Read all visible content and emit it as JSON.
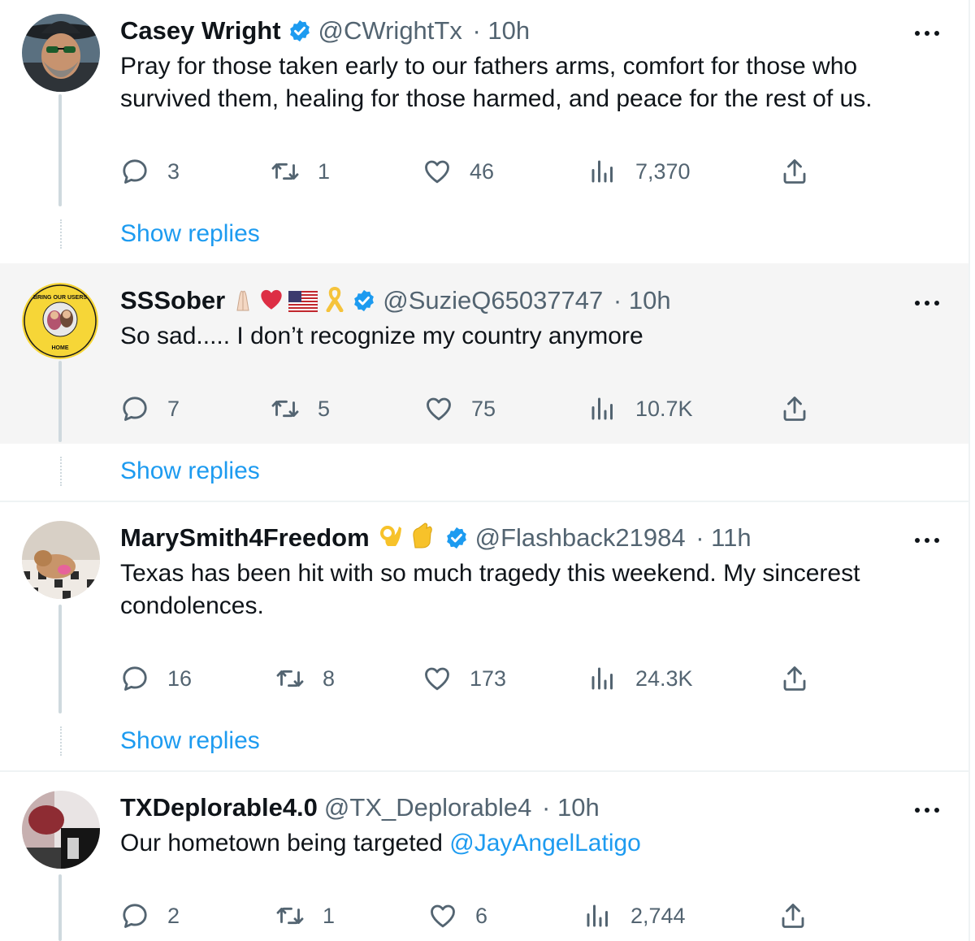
{
  "replies": [
    {
      "name": "Casey Wright",
      "handle": "@CWrightTx",
      "time": "· 10h",
      "verified": true,
      "text": "Pray for those taken early to our fathers arms, comfort for those who survived them, healing for those harmed, and peace for the rest of us.",
      "replies_count": "3",
      "retweets": "1",
      "likes": "46",
      "views": "7,370",
      "show_replies": "Show replies"
    },
    {
      "name": "SSSober",
      "name_emojis": [
        "folded-hands",
        "red-heart",
        "us-flag",
        "yellow-ribbon"
      ],
      "handle": "@SuzieQ65037747",
      "time": "· 10h",
      "verified": true,
      "avatar_text_top": "BRING OUR USERS",
      "avatar_text_bottom": "HOME",
      "text": "So sad..... I don’t recognize my country anymore",
      "replies_count": "7",
      "retweets": "5",
      "likes": "75",
      "views": "10.7K",
      "show_replies": "Show replies"
    },
    {
      "name": "MarySmith4Freedom",
      "name_emojis": [
        "ok-hand",
        "pinching-hand"
      ],
      "handle": "@Flashback21984",
      "time": "· 11h",
      "verified": true,
      "text": "Texas has been hit with so much tragedy this weekend. My sincerest condolences.",
      "replies_count": "16",
      "retweets": "8",
      "likes": "173",
      "views": "24.3K",
      "show_replies": "Show replies"
    },
    {
      "name": "TXDeplorable4.0",
      "handle": "@TX_Deplorable4",
      "time": "· 10h",
      "verified": false,
      "text": "Our hometown being targeted ",
      "mention": "@JayAngelLatigo",
      "replies_count": "2",
      "retweets": "1",
      "likes": "6",
      "views": "2,744"
    }
  ],
  "colors": {
    "link": "#1d9bf0",
    "secondary": "#536471",
    "verified": "#1d9bf0",
    "highlight_bg": "#f5f5f5",
    "thread_line": "#cfd9de"
  },
  "icons": [
    "reply-icon",
    "retweet-icon",
    "like-icon",
    "views-icon",
    "share-icon",
    "more-icon",
    "verified-badge-icon"
  ]
}
